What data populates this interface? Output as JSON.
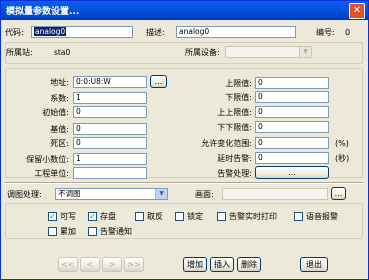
{
  "window": {
    "title": "模拟量参数设置...",
    "close_glyph": "✕"
  },
  "top": {
    "code_label": "代码:",
    "code_value": "analog0",
    "desc_label": "描述:",
    "desc_value": "analog0",
    "num_label": "编号:",
    "num_value": "0"
  },
  "station": {
    "station_label": "所属站:",
    "station_value": "sta0",
    "device_label": "所属设备:",
    "device_value": ""
  },
  "left": {
    "addr_label": "地址:",
    "addr_value": "0:0:U8:W",
    "addr_browse": "...",
    "coef_label": "系数:",
    "coef_value": "1",
    "init_label": "初始值:",
    "init_value": "0",
    "base_label": "基值:",
    "base_value": "0",
    "dead_label": "死区:",
    "dead_value": "0",
    "dec_label": "保留小数位:",
    "dec_value": "1",
    "unit_label": "工程单位:",
    "unit_value": ""
  },
  "right": {
    "ul_label": "上限值:",
    "ul_value": "0",
    "ll_label": "下限值:",
    "ll_value": "0",
    "uul_label": "上上限值:",
    "uul_value": "0",
    "lll_label": "下下限值:",
    "lll_value": "0",
    "range_label": "允许变化范围:",
    "range_value": "0",
    "range_unit": "(%)",
    "delay_label": "延时告警:",
    "delay_value": "0",
    "delay_unit": "(秒)",
    "alarm_label": "告警处理:",
    "alarm_btn": "..."
  },
  "curve": {
    "curve_label": "调图处理:",
    "curve_value": "不调图",
    "screen_label": "画面:",
    "screen_value": "",
    "screen_btn": "..."
  },
  "checks": [
    {
      "label": "可写",
      "checked": true
    },
    {
      "label": "存盘",
      "checked": true
    },
    {
      "label": "取反",
      "checked": false
    },
    {
      "label": "锁定",
      "checked": false
    },
    {
      "label": "告警实时打印",
      "checked": false
    },
    {
      "label": "语音报警",
      "checked": false
    },
    {
      "label": "累加",
      "checked": false
    },
    {
      "label": "告警通知",
      "checked": false
    }
  ],
  "nav": {
    "first": "<<",
    "prev": "<",
    "next": ">",
    "last": ">>"
  },
  "actions": {
    "add": "增加",
    "insert": "插入",
    "delete": "删除",
    "exit": "退出"
  },
  "check_glyph": "✓",
  "dropdown_glyph": "▼"
}
